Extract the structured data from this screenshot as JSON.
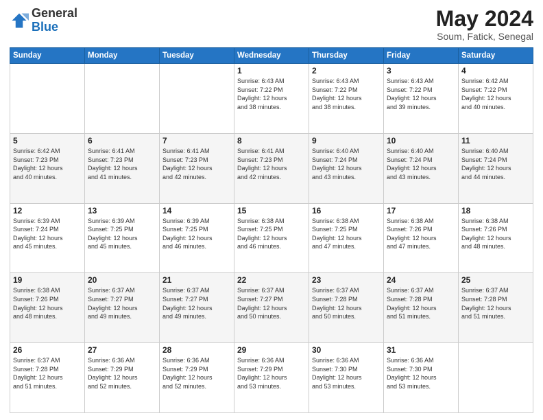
{
  "header": {
    "logo": {
      "general": "General",
      "blue": "Blue"
    },
    "title": "May 2024",
    "location": "Soum, Fatick, Senegal"
  },
  "weekdays": [
    "Sunday",
    "Monday",
    "Tuesday",
    "Wednesday",
    "Thursday",
    "Friday",
    "Saturday"
  ],
  "weeks": [
    [
      {
        "day": "",
        "info": ""
      },
      {
        "day": "",
        "info": ""
      },
      {
        "day": "",
        "info": ""
      },
      {
        "day": "1",
        "info": "Sunrise: 6:43 AM\nSunset: 7:22 PM\nDaylight: 12 hours\nand 38 minutes."
      },
      {
        "day": "2",
        "info": "Sunrise: 6:43 AM\nSunset: 7:22 PM\nDaylight: 12 hours\nand 38 minutes."
      },
      {
        "day": "3",
        "info": "Sunrise: 6:43 AM\nSunset: 7:22 PM\nDaylight: 12 hours\nand 39 minutes."
      },
      {
        "day": "4",
        "info": "Sunrise: 6:42 AM\nSunset: 7:22 PM\nDaylight: 12 hours\nand 40 minutes."
      }
    ],
    [
      {
        "day": "5",
        "info": "Sunrise: 6:42 AM\nSunset: 7:23 PM\nDaylight: 12 hours\nand 40 minutes."
      },
      {
        "day": "6",
        "info": "Sunrise: 6:41 AM\nSunset: 7:23 PM\nDaylight: 12 hours\nand 41 minutes."
      },
      {
        "day": "7",
        "info": "Sunrise: 6:41 AM\nSunset: 7:23 PM\nDaylight: 12 hours\nand 42 minutes."
      },
      {
        "day": "8",
        "info": "Sunrise: 6:41 AM\nSunset: 7:23 PM\nDaylight: 12 hours\nand 42 minutes."
      },
      {
        "day": "9",
        "info": "Sunrise: 6:40 AM\nSunset: 7:24 PM\nDaylight: 12 hours\nand 43 minutes."
      },
      {
        "day": "10",
        "info": "Sunrise: 6:40 AM\nSunset: 7:24 PM\nDaylight: 12 hours\nand 43 minutes."
      },
      {
        "day": "11",
        "info": "Sunrise: 6:40 AM\nSunset: 7:24 PM\nDaylight: 12 hours\nand 44 minutes."
      }
    ],
    [
      {
        "day": "12",
        "info": "Sunrise: 6:39 AM\nSunset: 7:24 PM\nDaylight: 12 hours\nand 45 minutes."
      },
      {
        "day": "13",
        "info": "Sunrise: 6:39 AM\nSunset: 7:25 PM\nDaylight: 12 hours\nand 45 minutes."
      },
      {
        "day": "14",
        "info": "Sunrise: 6:39 AM\nSunset: 7:25 PM\nDaylight: 12 hours\nand 46 minutes."
      },
      {
        "day": "15",
        "info": "Sunrise: 6:38 AM\nSunset: 7:25 PM\nDaylight: 12 hours\nand 46 minutes."
      },
      {
        "day": "16",
        "info": "Sunrise: 6:38 AM\nSunset: 7:25 PM\nDaylight: 12 hours\nand 47 minutes."
      },
      {
        "day": "17",
        "info": "Sunrise: 6:38 AM\nSunset: 7:26 PM\nDaylight: 12 hours\nand 47 minutes."
      },
      {
        "day": "18",
        "info": "Sunrise: 6:38 AM\nSunset: 7:26 PM\nDaylight: 12 hours\nand 48 minutes."
      }
    ],
    [
      {
        "day": "19",
        "info": "Sunrise: 6:38 AM\nSunset: 7:26 PM\nDaylight: 12 hours\nand 48 minutes."
      },
      {
        "day": "20",
        "info": "Sunrise: 6:37 AM\nSunset: 7:27 PM\nDaylight: 12 hours\nand 49 minutes."
      },
      {
        "day": "21",
        "info": "Sunrise: 6:37 AM\nSunset: 7:27 PM\nDaylight: 12 hours\nand 49 minutes."
      },
      {
        "day": "22",
        "info": "Sunrise: 6:37 AM\nSunset: 7:27 PM\nDaylight: 12 hours\nand 50 minutes."
      },
      {
        "day": "23",
        "info": "Sunrise: 6:37 AM\nSunset: 7:28 PM\nDaylight: 12 hours\nand 50 minutes."
      },
      {
        "day": "24",
        "info": "Sunrise: 6:37 AM\nSunset: 7:28 PM\nDaylight: 12 hours\nand 51 minutes."
      },
      {
        "day": "25",
        "info": "Sunrise: 6:37 AM\nSunset: 7:28 PM\nDaylight: 12 hours\nand 51 minutes."
      }
    ],
    [
      {
        "day": "26",
        "info": "Sunrise: 6:37 AM\nSunset: 7:28 PM\nDaylight: 12 hours\nand 51 minutes."
      },
      {
        "day": "27",
        "info": "Sunrise: 6:36 AM\nSunset: 7:29 PM\nDaylight: 12 hours\nand 52 minutes."
      },
      {
        "day": "28",
        "info": "Sunrise: 6:36 AM\nSunset: 7:29 PM\nDaylight: 12 hours\nand 52 minutes."
      },
      {
        "day": "29",
        "info": "Sunrise: 6:36 AM\nSunset: 7:29 PM\nDaylight: 12 hours\nand 53 minutes."
      },
      {
        "day": "30",
        "info": "Sunrise: 6:36 AM\nSunset: 7:30 PM\nDaylight: 12 hours\nand 53 minutes."
      },
      {
        "day": "31",
        "info": "Sunrise: 6:36 AM\nSunset: 7:30 PM\nDaylight: 12 hours\nand 53 minutes."
      },
      {
        "day": "",
        "info": ""
      }
    ]
  ]
}
